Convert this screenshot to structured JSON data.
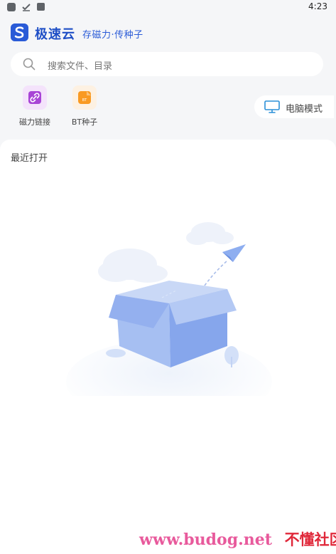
{
  "status_bar": {
    "time": "4:23"
  },
  "header": {
    "app_name": "极速云",
    "slogan": "存磁力·传种子"
  },
  "search": {
    "placeholder": "搜索文件、目录"
  },
  "quick_actions": [
    {
      "label": "磁力链接",
      "icon": "link-icon"
    },
    {
      "label": "BT种子",
      "icon": "bt-file-icon"
    }
  ],
  "pc_mode": {
    "label": "电脑模式",
    "icon": "monitor-icon"
  },
  "recent": {
    "title": "最近打开"
  },
  "empty_state": {
    "icon": "empty-box-illustration"
  },
  "watermark": {
    "url": "www.budog.net",
    "text": "不懂社区"
  },
  "colors": {
    "brand": "#2a5bd7",
    "magnet_accent": "#a844d6",
    "bt_accent": "#f99a22",
    "page_bg": "#f5f6f8",
    "watermark_pink": "#e85a9c",
    "watermark_red": "#e0283a"
  }
}
